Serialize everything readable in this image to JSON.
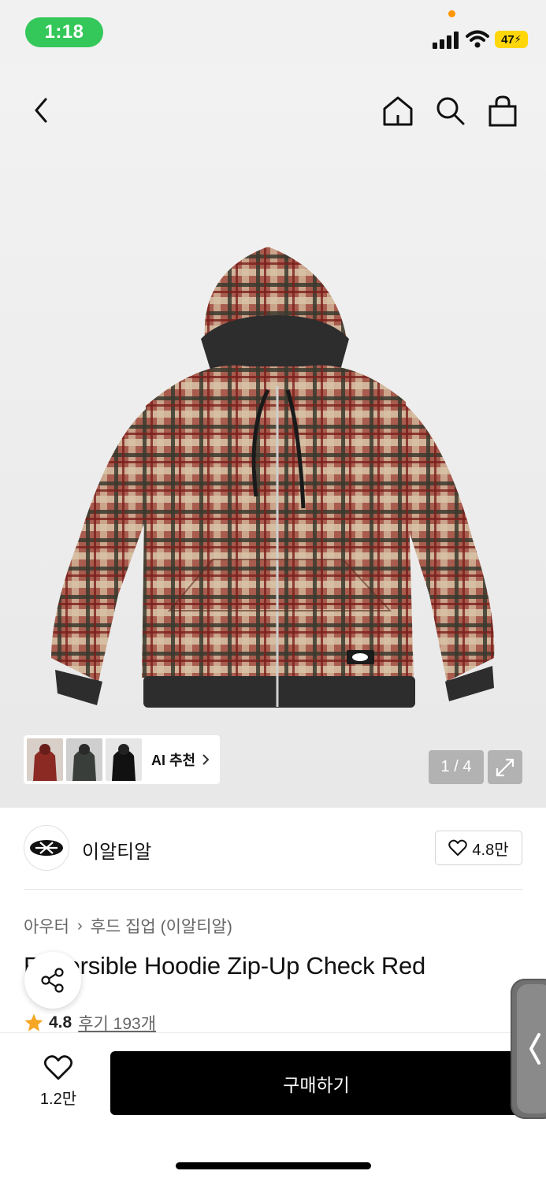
{
  "status_bar": {
    "time": "1:18",
    "battery": "47"
  },
  "hero": {
    "ai_recommend_label": "AI 추천",
    "pager": "1 / 4"
  },
  "brand": {
    "name": "이알티알",
    "likes": "4.8만"
  },
  "breadcrumb": {
    "category": "아우터",
    "subcategory": "후드 집업 (이알티알)"
  },
  "product": {
    "title": "Reversible Hoodie Zip-Up Check Red"
  },
  "rating": {
    "value": "4.8",
    "reviews_label": "후기 193개"
  },
  "bottom_bar": {
    "wish_count": "1.2만",
    "buy_label": "구매하기"
  },
  "colors": {
    "status_green": "#34c759",
    "battery_yellow": "#ffd60a",
    "star": "#f5a623",
    "buy_bg": "#000000"
  }
}
